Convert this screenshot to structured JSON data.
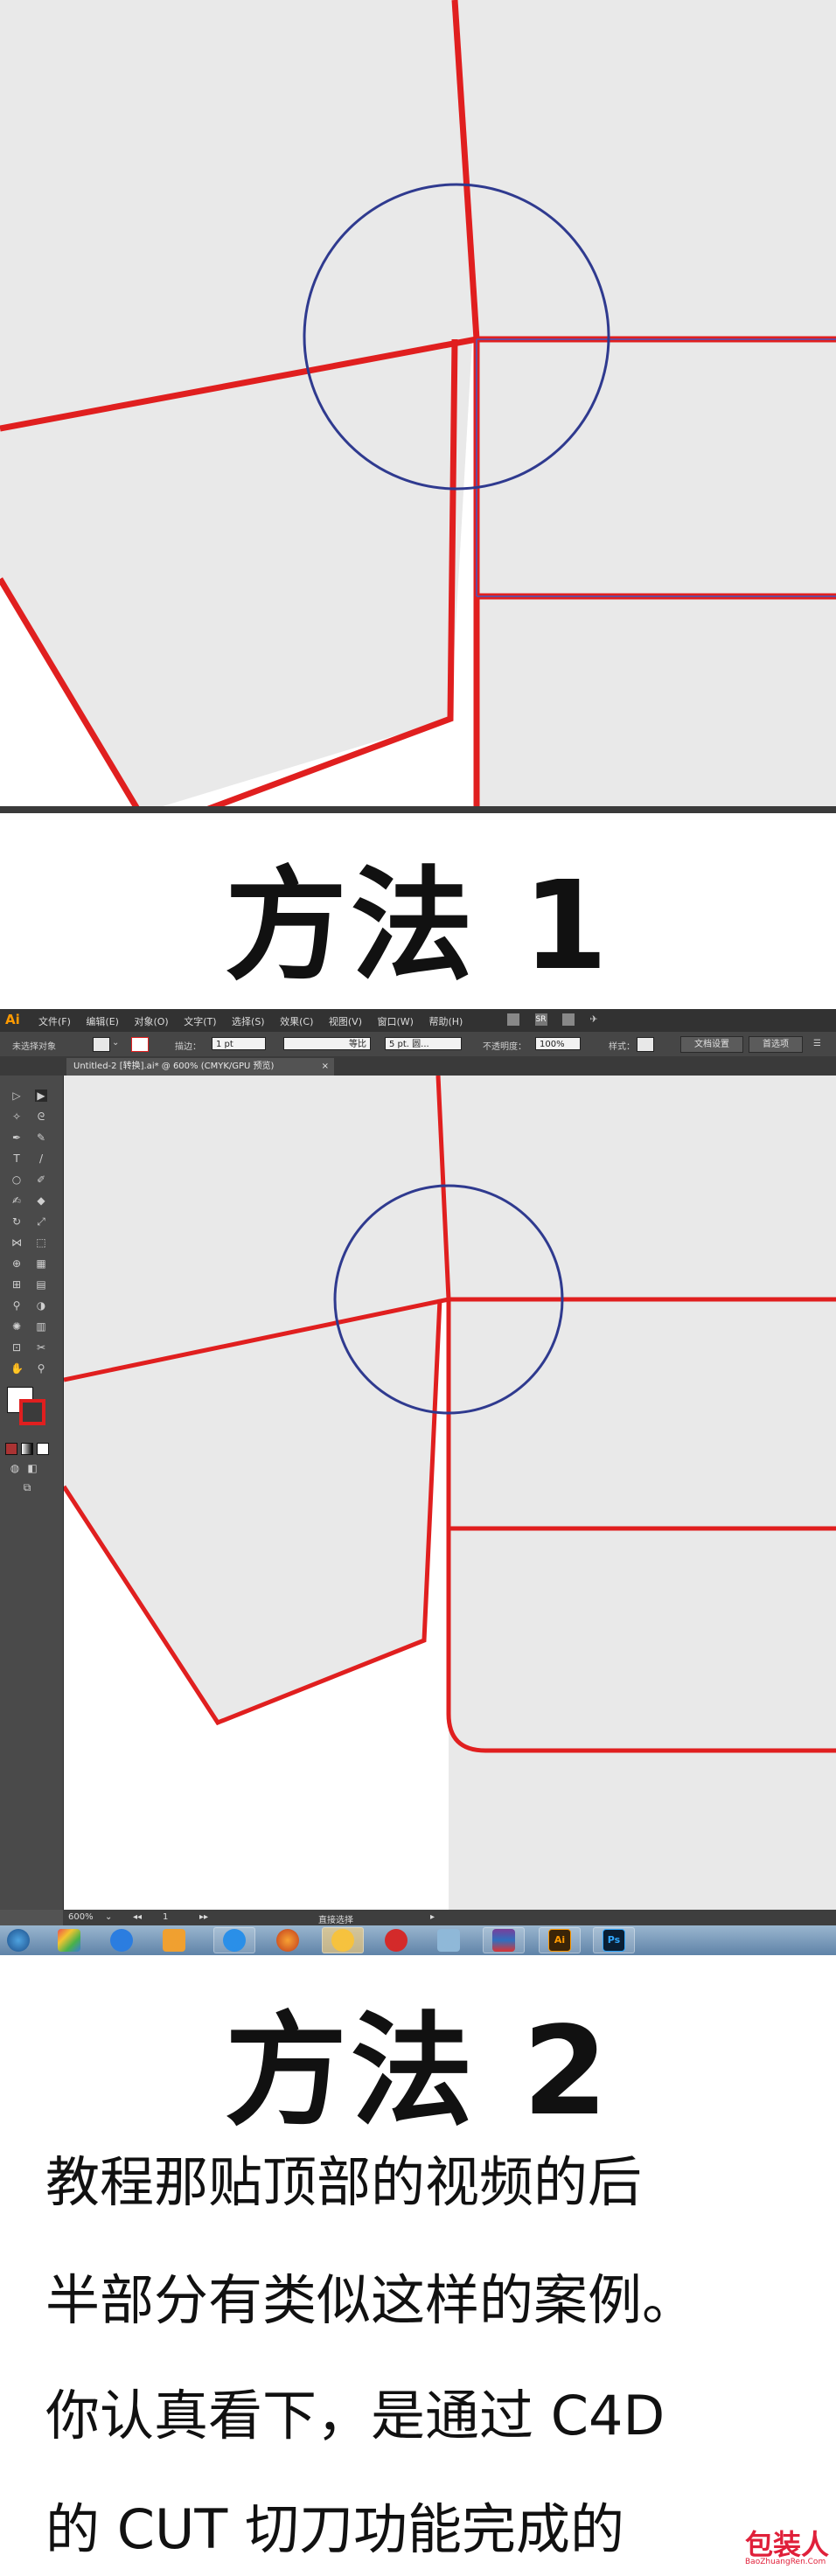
{
  "section1": {
    "title": "方法 1"
  },
  "section2": {
    "title": "方法 2",
    "app": {
      "logo": "Ai",
      "menu": [
        "文件(F)",
        "编辑(E)",
        "对象(O)",
        "文字(T)",
        "选择(S)",
        "效果(C)",
        "视图(V)",
        "窗口(W)",
        "帮助(H)"
      ],
      "menubar_extra": "SR",
      "control_bar": {
        "selection_label": "未选择对象",
        "stroke_label": "描边：",
        "stroke_weight": "1 pt",
        "stroke_style": "等比",
        "brush": "5 pt. 圆...",
        "opacity_label": "不透明度：",
        "opacity_value": "100%",
        "style_label": "样式：",
        "doc_setup": "文档设置",
        "preferences": "首选项"
      },
      "document_tab": {
        "title": "Untitled-2 [转换].ai* @ 600% (CMYK/GPU 预览)",
        "close": "×"
      },
      "status_bar": {
        "zoom": "600%",
        "artboard": "1",
        "tool": "直接选择"
      }
    }
  },
  "paragraph": {
    "lines": [
      "教程那贴顶部的视频的后",
      "半部分有类似这样的案例。",
      "你认真看下，是通过 C4D",
      "的 CUT 切刀功能完成的"
    ]
  },
  "watermark": {
    "text": "包装人",
    "url": "BaoZhuangRen.Com"
  },
  "colors": {
    "stroke_red": "#e01f1f",
    "circle_blue": "#2f3a8f",
    "shape_fill": "#e9e9e9",
    "ui_dark": "#535353"
  },
  "taskbar_icons": [
    "windows-start-icon",
    "apps-icon",
    "ie-icon",
    "file-manager-icon",
    "cloud-icon",
    "firefox-icon",
    "browser-icon",
    "bank-icon",
    "box-icon",
    "winrar-icon",
    "illustrator-icon",
    "photoshop-icon"
  ]
}
